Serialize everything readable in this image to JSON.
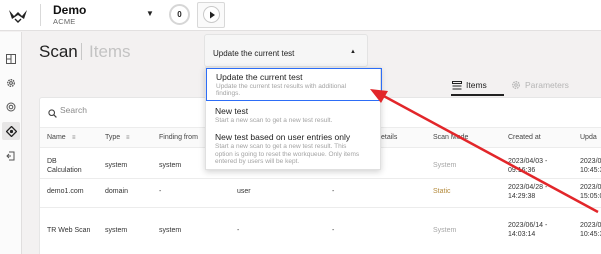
{
  "topbar": {
    "app_name": "Demo",
    "org_name": "ACME",
    "counter": "0",
    "caret": "▼"
  },
  "breadcrumb": {
    "main": "Scan",
    "sub": "Items"
  },
  "tabs": [
    {
      "label": "Items"
    },
    {
      "label": "Parameters"
    }
  ],
  "search": {
    "placeholder": "Search"
  },
  "table": {
    "columns": [
      "Name",
      "Type",
      "Finding from",
      "etails",
      "Scan Mode",
      "Created at",
      "Upda"
    ],
    "rows": [
      {
        "name_line1": "DB",
        "name_line2": "Calculation",
        "type": "system",
        "finding": "system",
        "col4": "",
        "col5": "",
        "mode": "System",
        "created_line1": "2023/04/03 -",
        "created_line2": "09:16:36",
        "updated_line1": "2023/0",
        "updated_line2": "10:45:3"
      },
      {
        "name_line1": "demo1.com",
        "name_line2": "",
        "type": "domain",
        "finding": "-",
        "col4": "user",
        "col5": "-",
        "mode": "Static",
        "created_line1": "2023/04/28 -",
        "created_line2": "14:29:38",
        "updated_line1": "2023/0",
        "updated_line2": "15:05:0"
      },
      {
        "name_line1": "TR Web Scan",
        "name_line2": "",
        "type": "system",
        "finding": "system",
        "col4": "-",
        "col5": "-",
        "mode": "System",
        "created_line1": "2023/06/14 -",
        "created_line2": "14:03:14",
        "updated_line1": "2023/0",
        "updated_line2": "10:45:3"
      }
    ]
  },
  "dropdown": {
    "selected_label": "Update the current test",
    "caret": "▲",
    "options": [
      {
        "title": "Update the current test",
        "desc_line1": "Update the current test results with additional",
        "desc_line2": "findings.",
        "desc_line3": ""
      },
      {
        "title": "New test",
        "desc_line1": "Start a new scan to get a new test result.",
        "desc_line2": "",
        "desc_line3": ""
      },
      {
        "title": "New test based on user entries only",
        "desc_line1": "Start a new scan to get a new test result. This",
        "desc_line2": "option is going to reset the workqueue. Only items",
        "desc_line3": "entered by users will be kept."
      }
    ]
  },
  "colors": {
    "accent_blue": "#2d6df6",
    "annotation_arrow": "#e2262a",
    "static_mode": "#b48a3c"
  },
  "icons": [
    "logo-icon",
    "grid-icon",
    "gear-icon",
    "radar-icon",
    "scan-icon",
    "export-icon",
    "play-icon",
    "search-icon",
    "filter-icon",
    "list-icon",
    "gear-outline-icon"
  ]
}
